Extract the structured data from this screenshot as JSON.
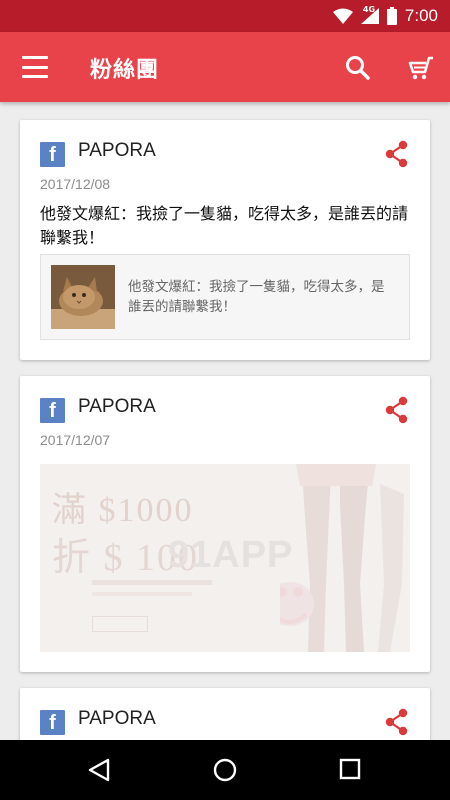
{
  "status_bar": {
    "time": "7:00",
    "network": "4G"
  },
  "app_bar": {
    "title": "粉絲團"
  },
  "posts": [
    {
      "source": "PAPORA",
      "date": "2017/12/08",
      "text": "他發文爆紅：我撿了一隻貓，吃得太多，是誰丟的請聯繫我！",
      "link_title": "他發文爆紅：我撿了一隻貓，吃得太多，是誰丟的請聯繫我！"
    },
    {
      "source": "PAPORA",
      "date": "2017/12/07",
      "promo": {
        "line1": "滿 $1000",
        "line2": "折 $ 100",
        "watermark": "91APP"
      }
    },
    {
      "source": "PAPORA"
    }
  ],
  "colors": {
    "accent": "#e8434b",
    "status_bar": "#b71c2a",
    "share_icon": "#d93a3a",
    "facebook": "#5b82c4"
  }
}
